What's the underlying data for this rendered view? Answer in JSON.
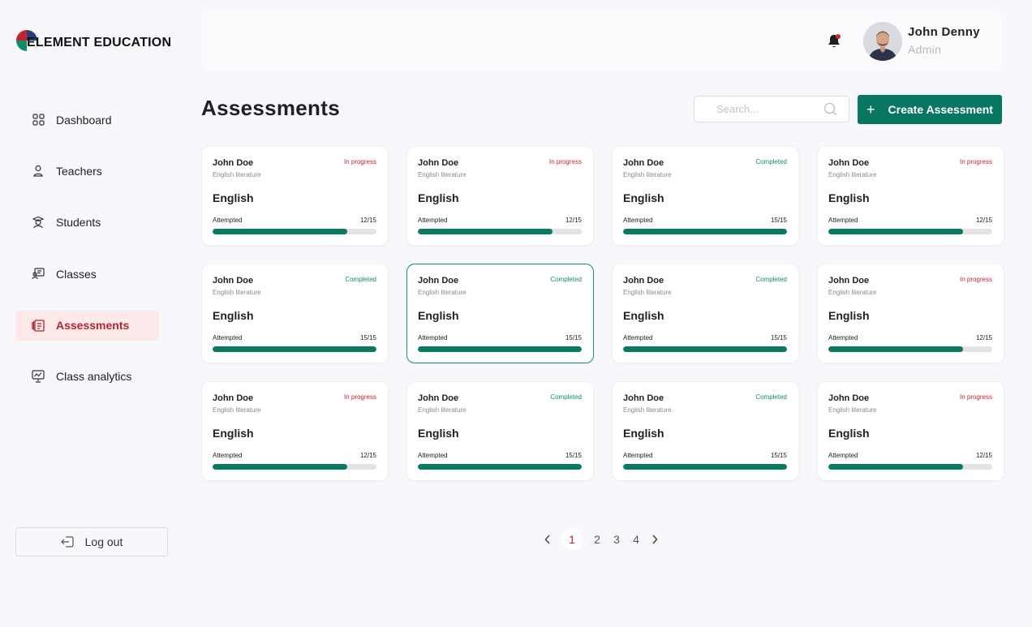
{
  "brand": {
    "name": "ELEMENT EDUCATION"
  },
  "sidebar": {
    "items": [
      {
        "label": "Dashboard",
        "icon": "grid-icon"
      },
      {
        "label": "Teachers",
        "icon": "user-icon"
      },
      {
        "label": "Students",
        "icon": "student-icon"
      },
      {
        "label": "Classes",
        "icon": "classroom-icon"
      },
      {
        "label": "Assessments",
        "icon": "assessment-icon",
        "active": true
      },
      {
        "label": "Class analytics",
        "icon": "analytics-icon"
      }
    ],
    "logout_label": "Log out"
  },
  "header": {
    "user": {
      "name": "John Denny",
      "role": "Admin"
    }
  },
  "main": {
    "title": "Assessments",
    "search_placeholder": "Search...",
    "create_label": "Create Assessment"
  },
  "colors": {
    "accent": "#077761",
    "danger": "#c0272d",
    "active_bg": "#fde9e9",
    "progress_fill": "#0a7a62"
  },
  "cards": [
    {
      "name": "John Doe",
      "course": "English literature",
      "status": "In progress",
      "status_type": "progress",
      "subject": "English",
      "attempt_label": "Attempted",
      "score": "12/15",
      "progress": 0.82
    },
    {
      "name": "John Doe",
      "course": "English literature",
      "status": "In progress",
      "status_type": "progress",
      "subject": "English",
      "attempt_label": "Attempted",
      "score": "12/15",
      "progress": 0.82
    },
    {
      "name": "John Doe",
      "course": "English literature",
      "status": "Completed",
      "status_type": "completed",
      "subject": "English",
      "attempt_label": "Attempted",
      "score": "15/15",
      "progress": 1.0
    },
    {
      "name": "John Doe",
      "course": "English literature",
      "status": "In progress",
      "status_type": "progress",
      "subject": "English",
      "attempt_label": "Attempted",
      "score": "12/15",
      "progress": 0.82
    },
    {
      "name": "John Doe",
      "course": "English literature",
      "status": "Completed",
      "status_type": "completed",
      "subject": "English",
      "attempt_label": "Attempted",
      "score": "15/15",
      "progress": 1.0
    },
    {
      "name": "John Doe",
      "course": "English literature",
      "status": "Completed",
      "status_type": "completed",
      "subject": "English",
      "attempt_label": "Attempted",
      "score": "15/15",
      "progress": 1.0,
      "selected": true
    },
    {
      "name": "John Doe",
      "course": "English literature",
      "status": "Completed",
      "status_type": "completed",
      "subject": "English",
      "attempt_label": "Attempted",
      "score": "15/15",
      "progress": 1.0
    },
    {
      "name": "John Doe",
      "course": "English literature",
      "status": "In progress",
      "status_type": "progress",
      "subject": "English",
      "attempt_label": "Attempted",
      "score": "12/15",
      "progress": 0.82
    },
    {
      "name": "John Doe",
      "course": "English literature",
      "status": "In progress",
      "status_type": "progress",
      "subject": "English",
      "attempt_label": "Attempted",
      "score": "12/15",
      "progress": 0.82
    },
    {
      "name": "John Doe",
      "course": "English literature",
      "status": "Completed",
      "status_type": "completed",
      "subject": "English",
      "attempt_label": "Attempted",
      "score": "15/15",
      "progress": 1.0
    },
    {
      "name": "John Doe",
      "course": "English literature",
      "status": "Completed",
      "status_type": "completed",
      "subject": "English",
      "attempt_label": "Attempted",
      "score": "15/15",
      "progress": 1.0
    },
    {
      "name": "John Doe",
      "course": "English literature",
      "status": "In progress",
      "status_type": "progress",
      "subject": "English",
      "attempt_label": "Attempted",
      "score": "12/15",
      "progress": 0.82
    }
  ],
  "pagination": {
    "current": "1",
    "pages": [
      "2",
      "3",
      "4"
    ]
  }
}
